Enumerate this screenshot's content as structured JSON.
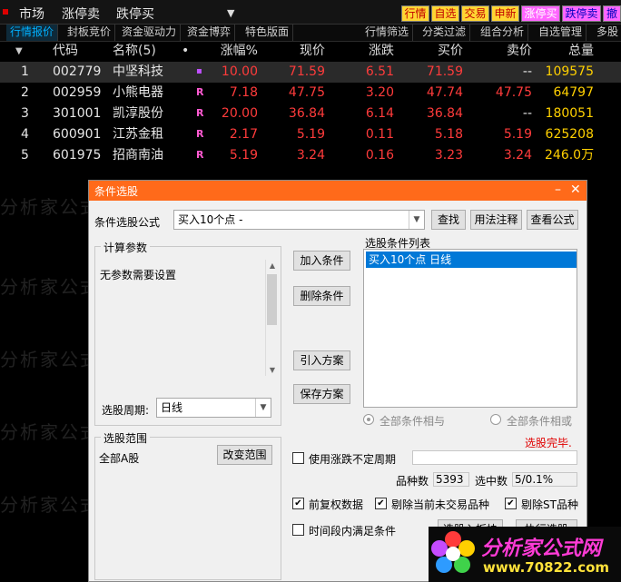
{
  "menu": {
    "items": [
      "市场",
      "涨停卖",
      "跌停买"
    ]
  },
  "quick_buttons": [
    {
      "label": "行情",
      "bg": "#ffd633",
      "fg": "#c00000"
    },
    {
      "label": "自选",
      "bg": "#ffd633",
      "fg": "#c00000"
    },
    {
      "label": "交易",
      "bg": "#ffd633",
      "fg": "#c00000"
    },
    {
      "label": "申新",
      "bg": "#ffd633",
      "fg": "#c00000"
    },
    {
      "label": "涨停买",
      "bg": "#ff66ff",
      "fg": "#ffffff"
    },
    {
      "label": "跌停卖",
      "bg": "#ff66ff",
      "fg": "#0000c0"
    },
    {
      "label": "撤",
      "bg": "#ff66ff",
      "fg": "#0000c0"
    }
  ],
  "tabs": [
    "行情报价",
    "封板竞价",
    "资金驱动力",
    "资金博弈",
    "特色版面",
    "行情筛选",
    "分类过滤",
    "组合分析",
    "自选管理",
    "多股"
  ],
  "table": {
    "headers": [
      "代码",
      "名称(5)",
      "•",
      "涨幅%",
      "现价",
      "涨跌",
      "买价",
      "卖价",
      "总量"
    ],
    "rows": [
      {
        "idx": "1",
        "code": "002779",
        "name": "中坚科技",
        "flag": "▪",
        "pct": "10.00",
        "price": "71.59",
        "chg": "6.51",
        "bid": "71.59",
        "ask": "--",
        "vol": "109575"
      },
      {
        "idx": "2",
        "code": "002959",
        "name": "小熊电器",
        "flag": "R",
        "pct": "7.18",
        "price": "47.75",
        "chg": "3.20",
        "bid": "47.74",
        "ask": "47.75",
        "vol": "64797"
      },
      {
        "idx": "3",
        "code": "301001",
        "name": "凯淳股份",
        "flag": "R",
        "pct": "20.00",
        "price": "36.84",
        "chg": "6.14",
        "bid": "36.84",
        "ask": "--",
        "vol": "180051"
      },
      {
        "idx": "4",
        "code": "600901",
        "name": "江苏金租",
        "flag": "R",
        "pct": "2.17",
        "price": "5.19",
        "chg": "0.11",
        "bid": "5.18",
        "ask": "5.19",
        "vol": "625208"
      },
      {
        "idx": "5",
        "code": "601975",
        "name": "招商南油",
        "flag": "R",
        "pct": "5.19",
        "price": "3.24",
        "chg": "0.16",
        "bid": "3.23",
        "ask": "3.24",
        "vol": "246.0万"
      }
    ]
  },
  "watermark": "分析家公式网www.70822.com分析家公式网",
  "dialog": {
    "title": "条件选股",
    "formula_label": "条件选股公式",
    "formula_value": "买入10个点  -",
    "find": "查找",
    "usage": "用法注释",
    "view_formula": "查看公式",
    "params_title": "计算参数",
    "params_text": "无参数需要设置",
    "add": "加入条件",
    "delete": "删除条件",
    "import": "引入方案",
    "save": "保存方案",
    "list_title": "选股条件列表",
    "list_item": "买入10个点  日线",
    "period_label": "选股周期:",
    "period_value": "日线",
    "and_label": "全部条件相与",
    "or_label": "全部条件相或",
    "status": "选股完毕.",
    "scope_title": "选股范围",
    "scope_value": "全部A股",
    "change_scope": "改变范围",
    "use_period": "使用涨跌不定周期",
    "count_label": "品种数",
    "count_value": "5393",
    "hit_label": "选中数",
    "hit_value": "5/0.1%",
    "pre_adjust": "前复权数据",
    "exclude_untraded": "剔除当前未交易品种",
    "exclude_st": "剔除ST品种",
    "time_cond": "时间段内满足条件",
    "to_block": "选股入板块",
    "execute": "执行选股"
  },
  "logo": {
    "line1": "分析家公式网",
    "line2": "www.70822.com"
  }
}
